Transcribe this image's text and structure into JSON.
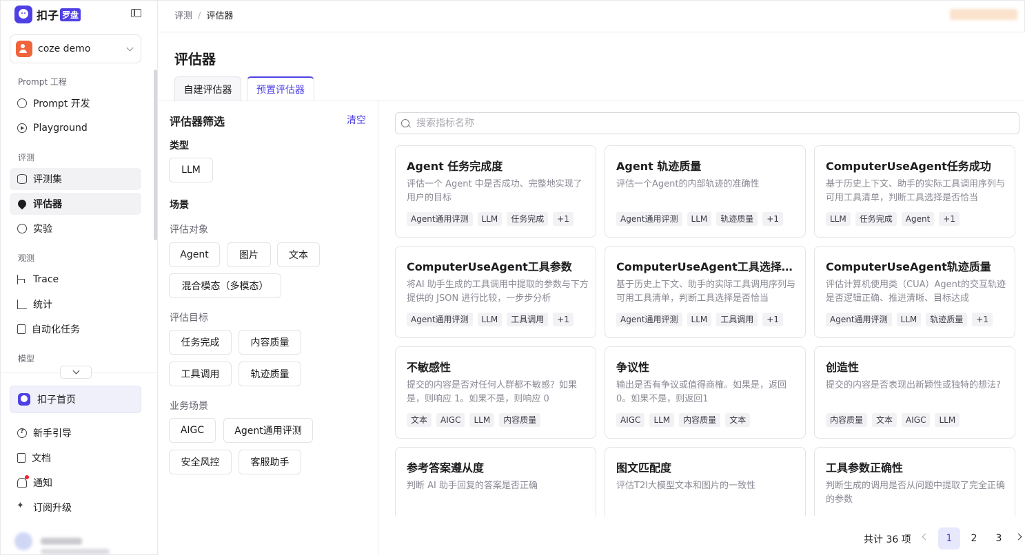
{
  "app": {
    "brand": "扣子",
    "badge": "罗盘"
  },
  "workspace": {
    "name": "coze demo"
  },
  "nav": {
    "sections": {
      "prompt": "Prompt 工程",
      "eval": "评测",
      "observe": "观测",
      "model": "模型"
    },
    "items": {
      "prompt_dev": "Prompt 开发",
      "playground": "Playground",
      "eval_set": "评测集",
      "evaluator": "评估器",
      "experiment": "实验",
      "trace": "Trace",
      "stats": "统计",
      "automation": "自动化任务"
    },
    "home": "扣子首页",
    "bottom": {
      "guide": "新手引导",
      "docs": "文档",
      "notify": "通知",
      "upgrade": "订阅升级"
    }
  },
  "breadcrumb": {
    "root": "评测",
    "sep": "/",
    "current": "评估器"
  },
  "page": {
    "title": "评估器"
  },
  "tabs": {
    "custom": "自建评估器",
    "preset": "预置评估器"
  },
  "filter": {
    "title": "评估器筛选",
    "clear": "清空",
    "type_label": "类型",
    "type_chips": [
      "LLM"
    ],
    "scene_label": "场景",
    "target_label": "评估对象",
    "target_chips": [
      "Agent",
      "图片",
      "文本",
      "混合模态（多模态）"
    ],
    "goal_label": "评估目标",
    "goal_chips": [
      "任务完成",
      "内容质量",
      "工具调用",
      "轨迹质量"
    ],
    "biz_label": "业务场景",
    "biz_chips": [
      "AIGC",
      "Agent通用评测",
      "安全风控",
      "客服助手"
    ]
  },
  "search": {
    "placeholder": "搜索指标名称",
    "value": ""
  },
  "cards": [
    {
      "title": "Agent 任务完成度",
      "desc": "评估一个 Agent 中是否成功、完整地实现了用户的目标",
      "tags": [
        "Agent通用评测",
        "LLM",
        "任务完成",
        "+1"
      ]
    },
    {
      "title": "Agent 轨迹质量",
      "desc": "评估一个Agent的内部轨迹的准确性",
      "tags": [
        "Agent通用评测",
        "LLM",
        "轨迹质量",
        "+1"
      ]
    },
    {
      "title": "ComputerUseAgent任务成功",
      "desc": "基于历史上下文、助手的实际工具调用序列与可用工具清单，判断工具选择是否恰当",
      "tags": [
        "LLM",
        "任务完成",
        "Agent",
        "+1"
      ]
    },
    {
      "title": "ComputerUseAgent工具参数",
      "desc": "将AI 助手生成的工具调用中提取的参数与下方提供的 JSON 进行比较，一步步分析",
      "tags": [
        "Agent通用评测",
        "LLM",
        "工具调用",
        "+1"
      ]
    },
    {
      "title": "ComputerUseAgent工具选择准确性",
      "desc": "基于历史上下文、助手的实际工具调用序列与可用工具清单，判断工具选择是否恰当",
      "tags": [
        "Agent通用评测",
        "LLM",
        "工具调用",
        "+1"
      ]
    },
    {
      "title": "ComputerUseAgent轨迹质量",
      "desc": "评估计算机使用类（CUA）Agent的交互轨迹是否逻辑正确、推进清晰、目标达成",
      "tags": [
        "Agent通用评测",
        "LLM",
        "轨迹质量",
        "+1"
      ]
    },
    {
      "title": "不敏感性",
      "desc": "提交的内容是否对任何人群都不敏感？如果是，则响应 1。如果不是，则响应 0",
      "tags": [
        "文本",
        "AIGC",
        "LLM",
        "内容质量"
      ]
    },
    {
      "title": "争议性",
      "desc": "输出是否有争议或值得商榷。如果是，返回0。如果不是，则返回1",
      "tags": [
        "AIGC",
        "LLM",
        "内容质量",
        "文本"
      ]
    },
    {
      "title": "创造性",
      "desc": "提交的内容是否表现出新颖性或独特的想法?",
      "tags": [
        "内容质量",
        "文本",
        "AIGC",
        "LLM"
      ]
    },
    {
      "title": "参考答案遵从度",
      "desc": "判断 AI 助手回复的答案是否正确",
      "tags": []
    },
    {
      "title": "图文匹配度",
      "desc": "评估T2I大模型文本和图片的一致性",
      "tags": []
    },
    {
      "title": "工具参数正确性",
      "desc": "判断生成的调用是否从问题中提取了完全正确的参数",
      "tags": []
    }
  ],
  "pagination": {
    "total": "共计 36 项",
    "pages": [
      "1",
      "2",
      "3"
    ],
    "current": "1"
  },
  "colors": {
    "accent": "#4e40e5",
    "brand_orange": "#f0643c"
  }
}
